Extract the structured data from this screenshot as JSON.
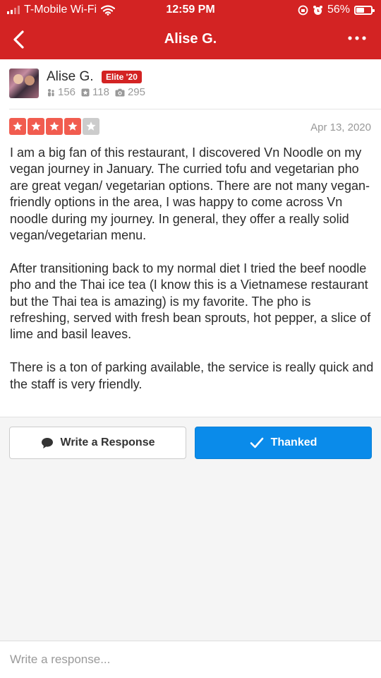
{
  "status_bar": {
    "carrier": "T-Mobile Wi-Fi",
    "time": "12:59 PM",
    "battery": "56%",
    "battery_level": 0.56
  },
  "nav": {
    "title": "Alise G."
  },
  "reviewer": {
    "name": "Alise G.",
    "badge": "Elite '20",
    "friends": "156",
    "reviews": "118",
    "photos": "295"
  },
  "review": {
    "rating": 4,
    "rating_max": 5,
    "date": "Apr 13, 2020",
    "paragraphs": [
      "I am a big fan of this restaurant, I discovered Vn Noodle on my vegan journey in January. The curried tofu and vegetarian pho are great vegan/ vegetarian options. There are not many vegan-friendly options in the area, I was happy to come across Vn noodle during my journey. In general, they offer a really solid vegan/vegetarian menu.",
      "After transitioning back to my normal diet I tried the beef noodle pho and the Thai ice tea (I know this is a Vietnamese restaurant but the Thai tea is amazing) is my favorite. The pho is refreshing, served with fresh bean sprouts, hot pepper, a slice of lime and basil leaves.",
      "There is a ton of parking available, the service is really quick and the staff is very friendly."
    ]
  },
  "actions": {
    "write_response": "Write a Response",
    "thanked": "Thanked"
  },
  "composer": {
    "placeholder": "Write a response..."
  },
  "colors": {
    "brand_red": "#d32323",
    "star_red": "#f15c4f",
    "thanked_blue": "#0a8bea"
  }
}
